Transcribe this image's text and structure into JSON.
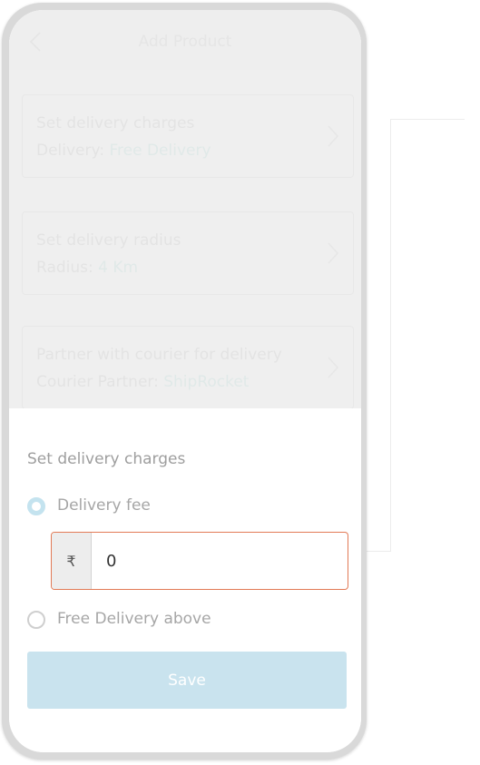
{
  "header": {
    "title": "Add Product"
  },
  "settings": [
    {
      "title": "Set delivery charges",
      "label": "Delivery: ",
      "value": "Free Delivery"
    },
    {
      "title": "Set delivery radius",
      "label": "Radius: ",
      "value": "4 Km"
    },
    {
      "title": "Partner with courier for delivery",
      "label": "Courier Partner: ",
      "value": "ShipRocket"
    }
  ],
  "sheet": {
    "title": "Set delivery charges",
    "options": [
      {
        "label": "Delivery fee",
        "selected": true
      },
      {
        "label": "Free Delivery above",
        "selected": false
      }
    ],
    "fee": {
      "currency_symbol": "₹",
      "value": "0"
    },
    "save_label": "Save"
  },
  "colors": {
    "accent_value": "#a9dbd6",
    "input_border": "#e27a56",
    "save_button": "#c9e3ee",
    "radio_selected": "#c4e3ef"
  },
  "icons": [
    "back-icon",
    "chevron-right-icon"
  ]
}
